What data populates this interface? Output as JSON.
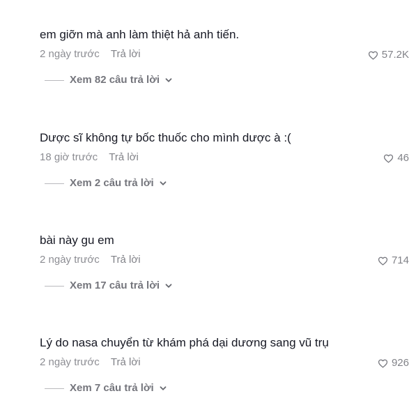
{
  "comments": [
    {
      "text": "em giỡn mà anh làm thiệt hả anh tiến.",
      "time": "2 ngày trước",
      "reply_label": "Trả lời",
      "likes": "57.2K",
      "view_replies": "Xem 82 câu trả lời"
    },
    {
      "text": "Dược sĩ không tự bốc thuốc cho mình dược à :(",
      "time": "18 giờ trước",
      "reply_label": "Trả lời",
      "likes": "46",
      "view_replies": "Xem 2 câu trả lời"
    },
    {
      "text": "bài này gu em",
      "time": "2 ngày trước",
      "reply_label": "Trả lời",
      "likes": "714",
      "view_replies": "Xem 17 câu trả lời"
    },
    {
      "text": "Lý do nasa chuyển từ khám phá dại dương sang vũ trụ",
      "time": "2 ngày trước",
      "reply_label": "Trả lời",
      "likes": "926",
      "view_replies": "Xem 7 câu trả lời"
    }
  ],
  "icons": {
    "like": "heart-outline-icon",
    "expand": "chevron-down-icon"
  }
}
